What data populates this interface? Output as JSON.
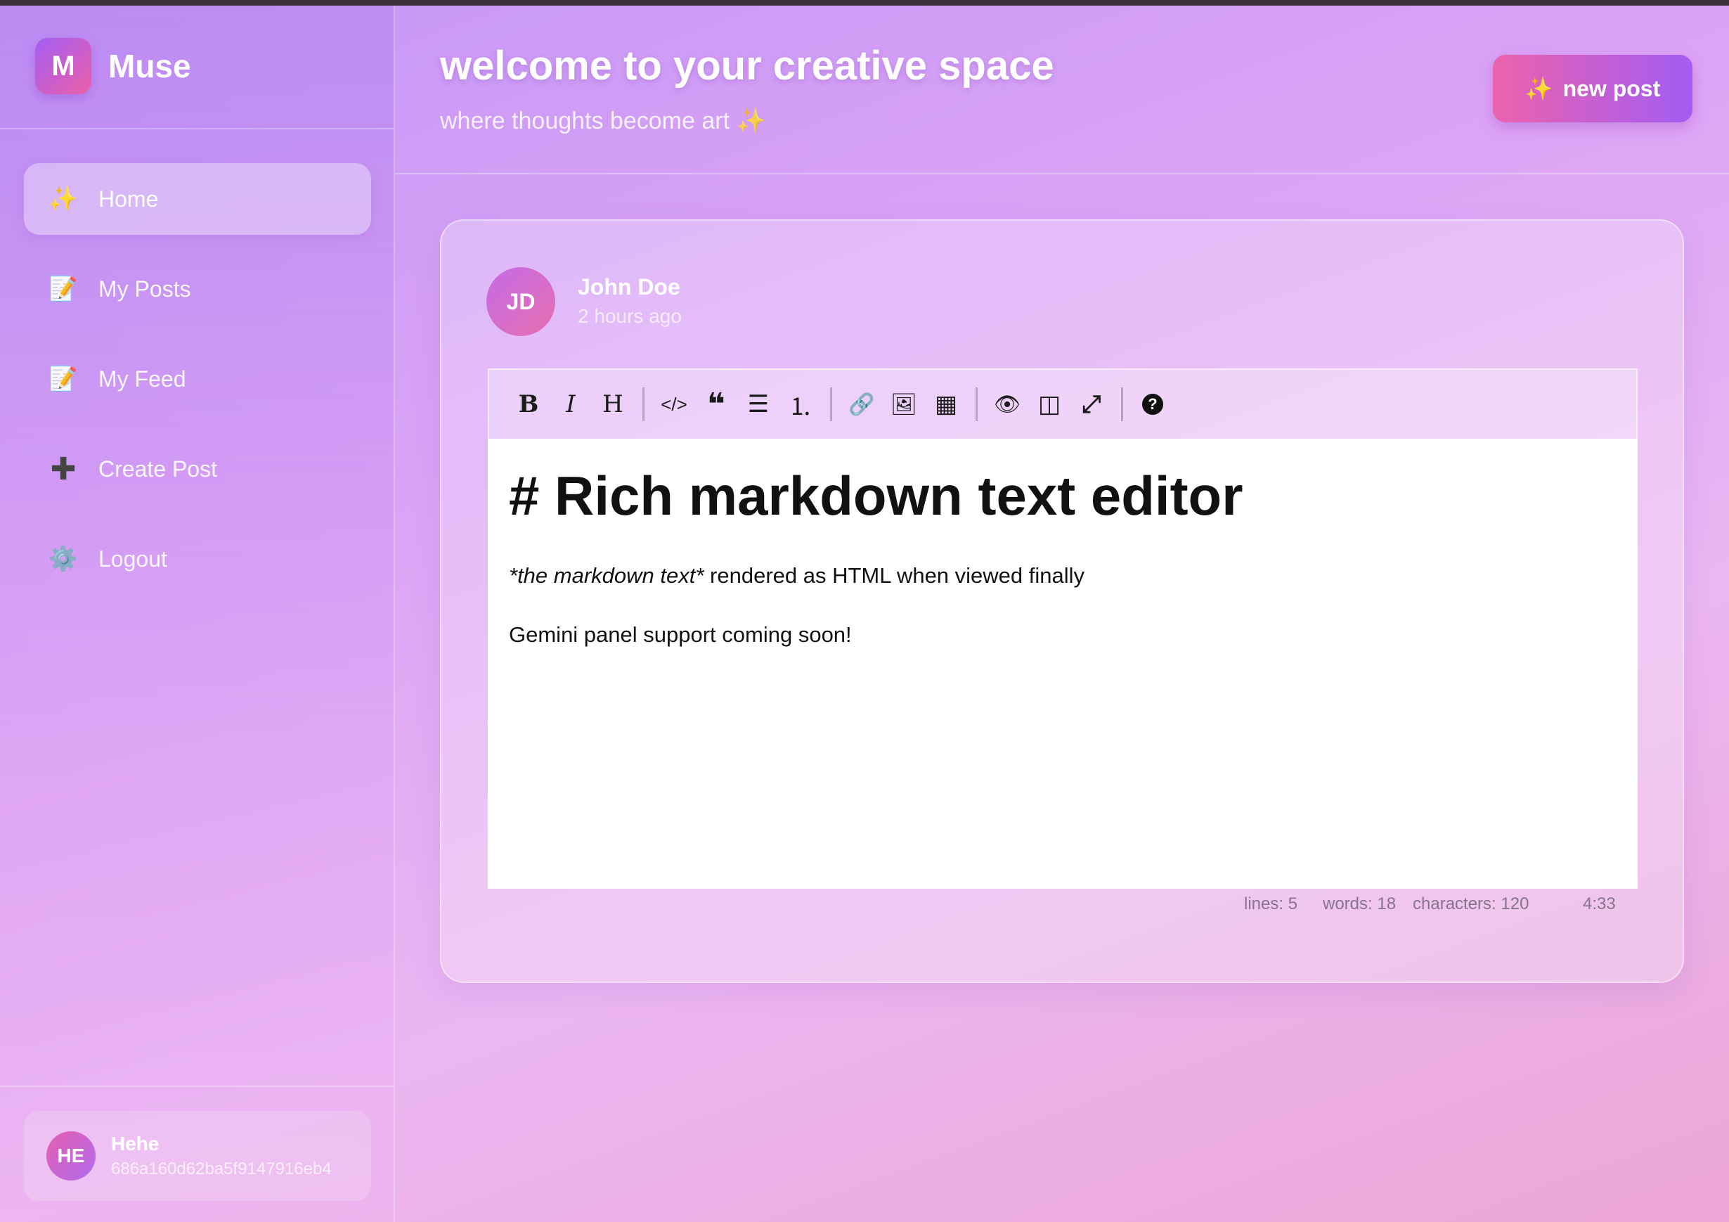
{
  "brand": {
    "logo_letter": "M",
    "name": "Muse"
  },
  "sidebar": {
    "items": [
      {
        "icon": "✨",
        "label": "Home",
        "active": true
      },
      {
        "icon": "📝",
        "label": "My Posts"
      },
      {
        "icon": "📝",
        "label": "My Feed"
      },
      {
        "icon": "✚",
        "label": "Create Post"
      },
      {
        "icon": "⚙️",
        "label": "Logout"
      }
    ],
    "user": {
      "initials": "HE",
      "name": "Hehe",
      "id": "686a160d62ba5f9147916eb4"
    }
  },
  "header": {
    "title": "welcome to your creative space",
    "subtitle": "where thoughts become art ✨",
    "new_post_icon": "✨",
    "new_post_label": "new post"
  },
  "post": {
    "author_initials": "JD",
    "author_name": "John Doe",
    "time": "2 hours ago"
  },
  "editor": {
    "toolbar": {
      "bold": "B",
      "italic": "I",
      "heading": "H",
      "code": "</>",
      "quote": "❝",
      "ul": "☰",
      "ol": "⒈",
      "link": "🔗",
      "image": "🖼",
      "table": "▦",
      "preview": "👁",
      "side_by_side": "◫",
      "fullscreen": "⤢",
      "guide": "?"
    },
    "heading_line": "# Rich markdown text editor",
    "line1_em": "*the markdown text*",
    "line1_rest": " rendered as HTML when viewed finally",
    "line2": "Gemini panel support coming soon!"
  },
  "status": {
    "lines": "lines: 5",
    "words": "words: 18",
    "characters": "characters: 120",
    "cursor": "4:33"
  }
}
